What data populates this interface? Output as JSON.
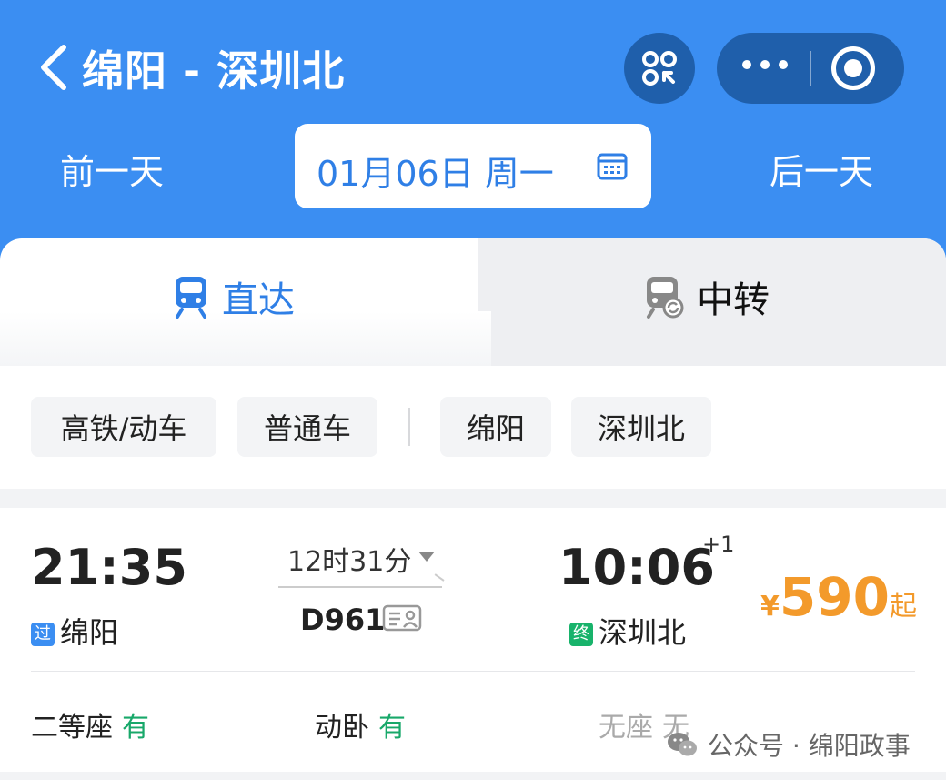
{
  "header": {
    "title": "绵阳 - 深圳北",
    "prev_day": "前一天",
    "next_day": "后一天",
    "date": "01月06日 周一"
  },
  "tabs": [
    {
      "label": "直达",
      "active": true
    },
    {
      "label": "中转",
      "active": false
    }
  ],
  "filters": [
    {
      "label": "高铁/动车"
    },
    {
      "label": "普通车"
    },
    {
      "label": "绵阳"
    },
    {
      "label": "深圳北"
    }
  ],
  "train": {
    "departure_time": "21:35",
    "departure_tag": "过",
    "departure_station": "绵阳",
    "duration": "12时31分",
    "train_number": "D961",
    "arrival_time": "10:06",
    "arrival_day_offset": "+1",
    "arrival_tag": "终",
    "arrival_station": "深圳北",
    "price_symbol": "¥",
    "price": "590",
    "price_suffix": "起",
    "seats": [
      {
        "type": "二等座",
        "status": "有"
      },
      {
        "type": "动卧",
        "status": "有"
      },
      {
        "type": "无座",
        "status": "无"
      }
    ]
  },
  "watermark": "公众号 · 绵阳政事",
  "colors": {
    "header_bg": "#3b8ef2",
    "accent": "#2f7fe6",
    "price": "#f39a2b",
    "available": "#18a86a"
  }
}
